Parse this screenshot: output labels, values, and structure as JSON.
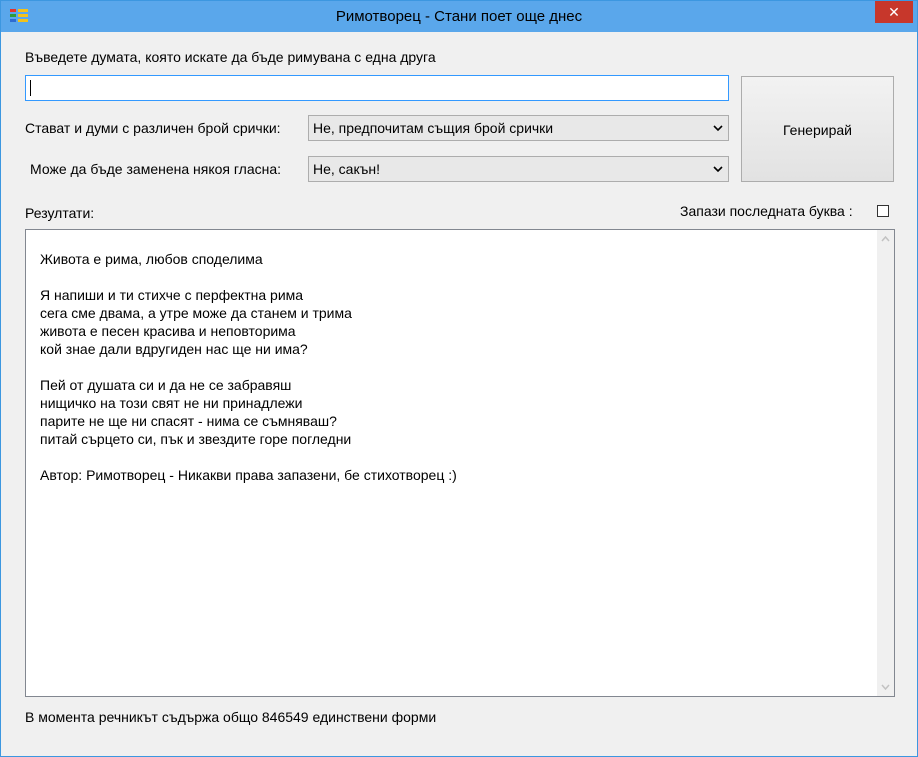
{
  "window": {
    "title": "Римотворец - Стани поет още днес",
    "close_symbol": "✕"
  },
  "input_section": {
    "prompt_label": "Въведете думата, която искате да бъде римувана с една друга",
    "word_value": ""
  },
  "options": {
    "syllables_label": "Стават и думи с различен брой срички:",
    "syllables_selected": "Не, предпочитам същия брой срички",
    "vowel_label": "Може да бъде заменена някоя гласна:",
    "vowel_selected": "Не, сакън!"
  },
  "generate_button": {
    "label": "Генерирай"
  },
  "results": {
    "label": "Резултати:",
    "keep_last_letter_label": "Запази последната буква :",
    "keep_last_letter_checked": false,
    "text": "Живота е рима, любов споделима\n\nЯ напиши и ти стихче с перфектна рима\nсега сме двама, а утре може да станем и трима\nживота е песен красива и неповторима\nкой знае дали вдругиден нас ще ни има?\n\nПей от душата си и да не се забравяш\nнищичко на този свят не ни принадлежи\nпарите не ще ни спасят - нима се съмняваш?\nпитай сърцето си, пък и звездите горе погледни\n\nАвтор: Римотворец - Никакви права запазени, бе стихотворец :)"
  },
  "status": {
    "text": "В момента речникът съдържа общо 846549 единствени форми"
  },
  "icons": {
    "app": "app-icon",
    "close": "close-icon",
    "dropdown": "chevron-down-icon"
  }
}
